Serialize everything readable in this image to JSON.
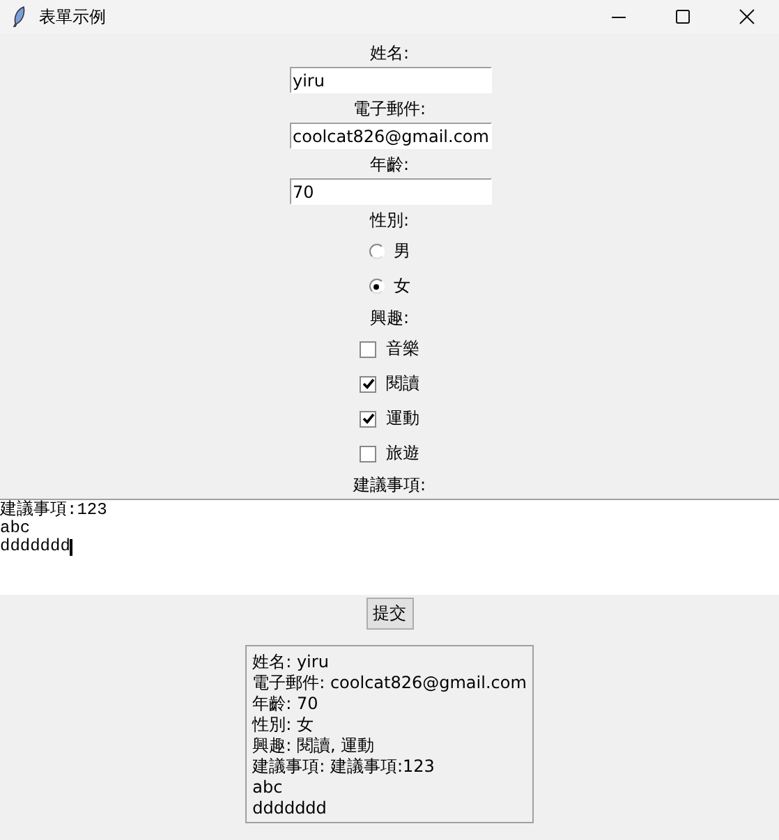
{
  "window": {
    "title": "表單示例"
  },
  "fields": [
    {
      "label": "姓名:",
      "value": "yiru"
    },
    {
      "label": "電子郵件:",
      "value": "coolcat826@gmail.com"
    },
    {
      "label": "年齡:",
      "value": "70"
    }
  ],
  "gender": {
    "label": "性別:",
    "options": [
      {
        "label": "男",
        "selected": false
      },
      {
        "label": "女",
        "selected": true
      }
    ]
  },
  "interests": {
    "label": "興趣:",
    "options": [
      {
        "label": "音樂",
        "checked": false
      },
      {
        "label": "閱讀",
        "checked": true
      },
      {
        "label": "運動",
        "checked": true
      },
      {
        "label": "旅遊",
        "checked": false
      }
    ]
  },
  "suggestions": {
    "label": "建議事項:",
    "lines": [
      "建議事項:123",
      "abc",
      "ddddddd"
    ]
  },
  "submit_button": "提交",
  "result": [
    "姓名: yiru",
    "電子郵件: coolcat826@gmail.com",
    "年齡: 70",
    "性別: 女",
    "興趣: 閱讀, 運動",
    "建議事項: 建議事項:123",
    "abc",
    "ddddddd"
  ]
}
